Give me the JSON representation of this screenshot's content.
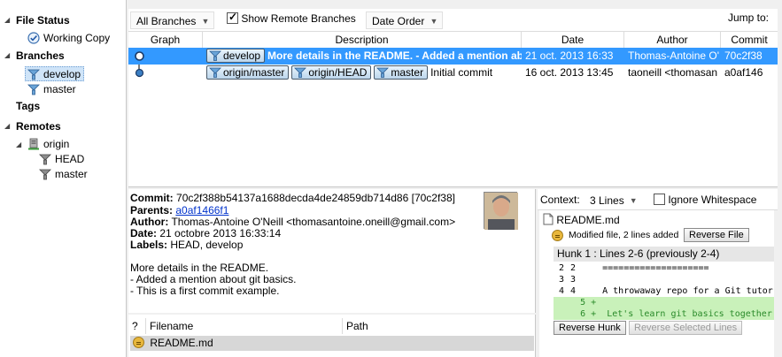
{
  "sidebar": {
    "file_status": {
      "heading": "File Status",
      "items": [
        {
          "label": "Working Copy",
          "icon": "checkmark-circle-icon"
        }
      ]
    },
    "branches": {
      "heading": "Branches",
      "items": [
        {
          "label": "develop",
          "icon": "branch-icon",
          "selected": true
        },
        {
          "label": "master",
          "icon": "branch-icon"
        }
      ]
    },
    "tags": {
      "heading": "Tags"
    },
    "remotes": {
      "heading": "Remotes",
      "remote": {
        "label": "origin",
        "icon": "server-icon"
      },
      "items": [
        {
          "label": "HEAD",
          "icon": "branch-icon"
        },
        {
          "label": "master",
          "icon": "branch-icon"
        }
      ]
    }
  },
  "toolbar": {
    "branch_filter": "All Branches",
    "show_remote_label": "Show Remote Branches",
    "show_remote_checked": true,
    "order": "Date Order",
    "jump_to_label": "Jump to:"
  },
  "grid": {
    "columns": {
      "graph": "Graph",
      "description": "Description",
      "date": "Date",
      "author": "Author",
      "commit": "Commit"
    },
    "rows": [
      {
        "tags": [
          "develop"
        ],
        "description": "More details in the README. - Added a mention ab",
        "date": "21 oct. 2013 16:33",
        "author": "Thomas-Antoine O'",
        "commit": "70c2f38"
      },
      {
        "tags": [
          "origin/master",
          "origin/HEAD",
          "master"
        ],
        "description": "Initial commit",
        "date": "16 oct. 2013 13:45",
        "author": "taoneill <thomasan",
        "commit": "a0af146"
      }
    ]
  },
  "details": {
    "commit_label": "Commit:",
    "commit_value": "70c2f388b54137a1688decda4de24859db714d86 [70c2f38]",
    "parents_label": "Parents:",
    "parents_value": "a0af1466f1",
    "author_label": "Author:",
    "author_value": "Thomas-Antoine O'Neill <thomasantoine.oneill@gmail.com>",
    "date_label": "Date:",
    "date_value": "21 octobre 2013 16:33:14",
    "labels_label": "Labels:",
    "labels_value": "HEAD, develop",
    "message": [
      "More details in the README.",
      "- Added a mention about git basics.",
      "- This is a first commit example."
    ]
  },
  "files": {
    "columns": {
      "status": "?",
      "filename": "Filename",
      "path": "Path"
    },
    "rows": [
      {
        "status_icon": "modified-file-icon",
        "filename": "README.md",
        "path": ""
      }
    ]
  },
  "diff": {
    "context_label": "Context:",
    "context_value": "3 Lines",
    "ignore_whitespace_label": "Ignore Whitespace",
    "ignore_whitespace_checked": false,
    "file_name": "README.md",
    "file_status": "Modified file, 2 lines added",
    "reverse_file_label": "Reverse File",
    "hunk_header": "Hunk 1 : Lines 2-6 (previously 2-4)",
    "lines": [
      {
        "old": "2",
        "new": "2",
        "sign": " ",
        "text": "===================="
      },
      {
        "old": "3",
        "new": "3",
        "sign": " ",
        "text": ""
      },
      {
        "old": "4",
        "new": "4",
        "sign": " ",
        "text": "A throwaway repo for a Git tutor"
      },
      {
        "old": "",
        "new": "5",
        "sign": "+",
        "text": ""
      },
      {
        "old": "",
        "new": "6",
        "sign": "+",
        "text": "Let's learn git basics together!"
      }
    ],
    "reverse_hunk_label": "Reverse Hunk",
    "reverse_selected_label": "Reverse Selected Lines"
  }
}
